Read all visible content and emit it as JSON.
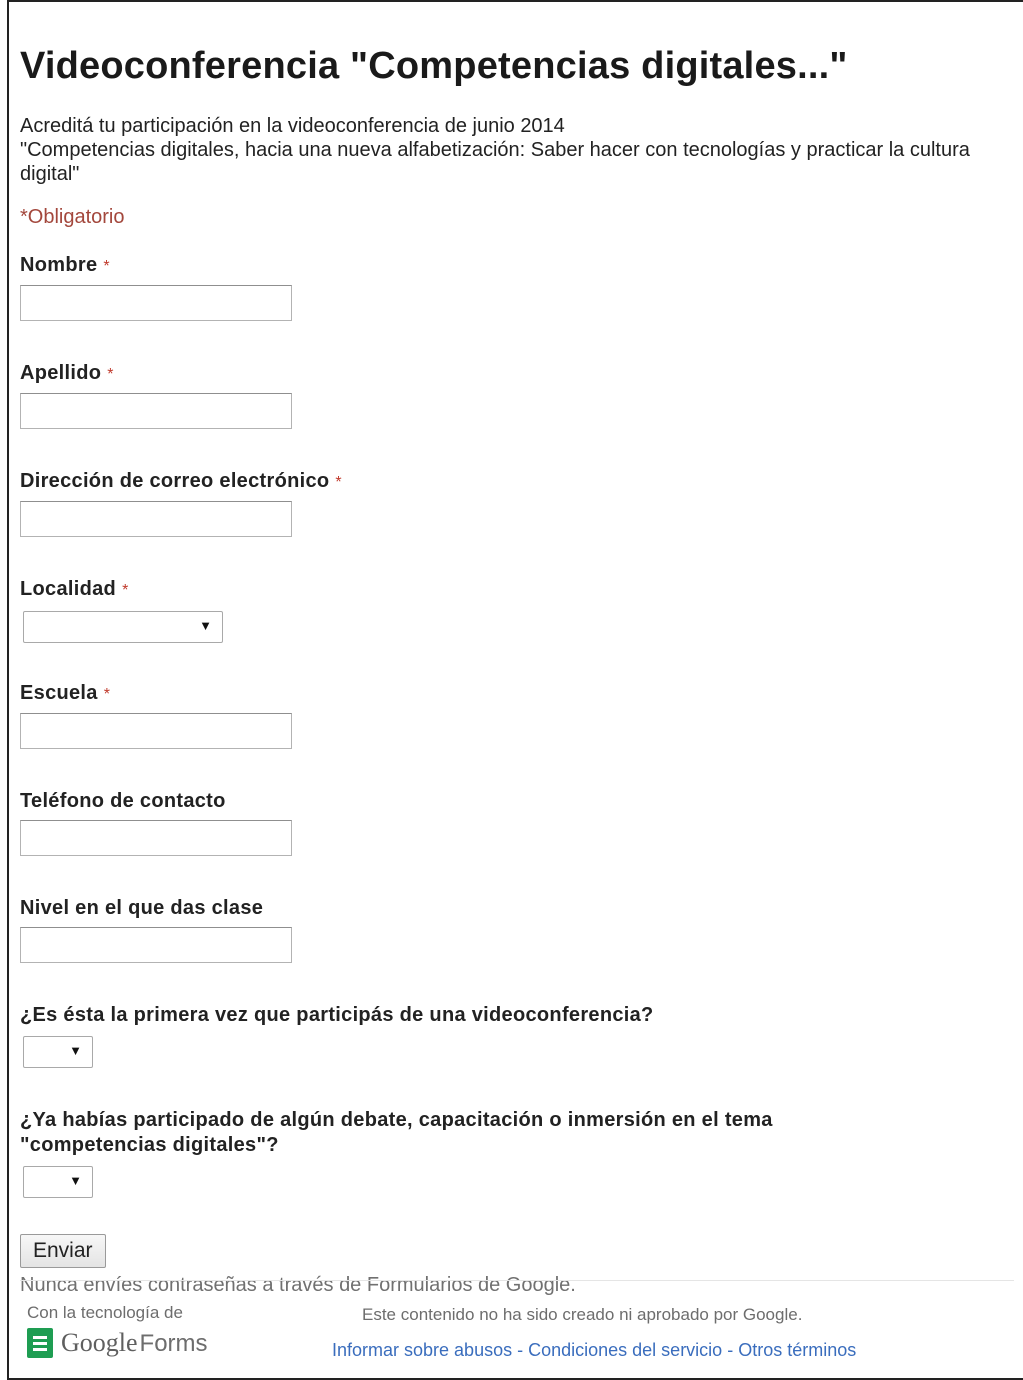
{
  "form": {
    "title": "Videoconferencia \"Competencias digitales...\"",
    "description_line1": "Acreditá tu participación en la videoconferencia de junio 2014",
    "description_line2": "\"Competencias digitales, hacia una nueva alfabetización: Saber hacer con tecnologías y practicar la cultura digital\"",
    "required_note": "*Obligatorio",
    "required_marker": "*",
    "questions": [
      {
        "label": "Nombre",
        "required": true,
        "type": "text",
        "value": ""
      },
      {
        "label": "Apellido",
        "required": true,
        "type": "text",
        "value": ""
      },
      {
        "label": "Dirección de correo electrónico",
        "required": true,
        "type": "text",
        "value": ""
      },
      {
        "label": "Localidad",
        "required": true,
        "type": "select",
        "value": ""
      },
      {
        "label": "Escuela",
        "required": true,
        "type": "text",
        "value": ""
      },
      {
        "label": "Teléfono de contacto",
        "required": false,
        "type": "text",
        "value": ""
      },
      {
        "label": "Nivel en el que das clase",
        "required": false,
        "type": "text",
        "value": ""
      },
      {
        "label": "¿Es ésta la primera vez que participás de una videoconferencia?",
        "required": false,
        "type": "select",
        "value": ""
      },
      {
        "label": "¿Ya habías participado de algún debate, capacitación o inmersión en el tema \"competencias digitales\"?",
        "required": false,
        "type": "select",
        "value": ""
      }
    ],
    "submit_label": "Enviar",
    "password_warning": "Nunca envíes contraseñas a través de Formularios de Google."
  },
  "footer": {
    "powered_by": "Con la tecnología de",
    "logo_google": "Google",
    "logo_forms": "Forms",
    "disclaimer": "Este contenido no ha sido creado ni aprobado por Google.",
    "links": [
      "Informar sobre abusos",
      "Condiciones del servicio",
      "Otros términos"
    ],
    "link_separator": " - "
  },
  "colors": {
    "required_note": "#a3473c",
    "link": "#3a6dbd",
    "logo_green": "#1e9d52"
  }
}
